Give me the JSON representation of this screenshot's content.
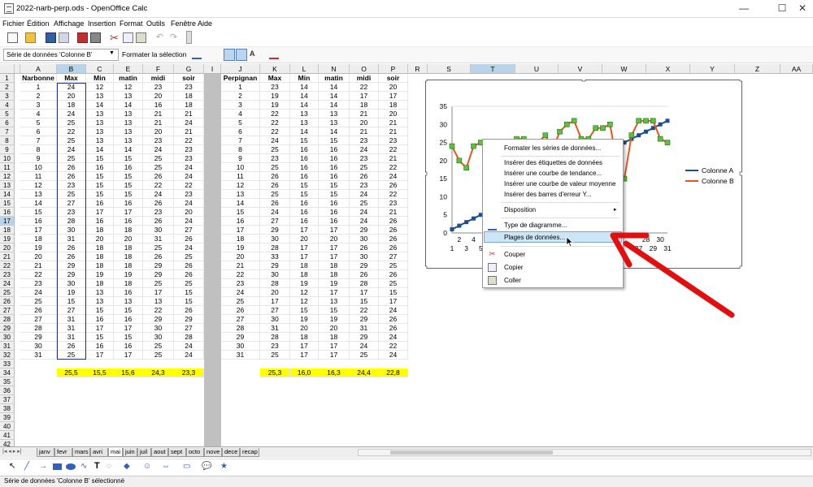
{
  "window": {
    "title": "2022-narb-perp.ods - OpenOffice Calc",
    "controls": [
      "—",
      "☐",
      "✕"
    ]
  },
  "menu": [
    "Fichier",
    "Édition",
    "Affichage",
    "Insertion",
    "Format",
    "Outils",
    "Fenêtre",
    "Aide"
  ],
  "toolbar2": {
    "name_box": "Série de données 'Colonne B'",
    "format_selection": "Formater la sélection"
  },
  "columns": [
    "A",
    "B",
    "C",
    "E",
    "F",
    "G",
    "I",
    "J",
    "K",
    "L",
    "N",
    "O",
    "P",
    "R",
    "S",
    "T",
    "U",
    "V",
    "W",
    "X",
    "Y",
    "Z",
    "AA"
  ],
  "headers_left": [
    "Narbonne",
    "Max",
    "Min",
    "matin",
    "midi",
    "soir"
  ],
  "headers_right": [
    "Perpignan",
    "Max",
    "Min",
    "matin",
    "midi",
    "soir"
  ],
  "rows": [
    [
      "1",
      "24",
      "12",
      "12",
      "23",
      "23",
      "1",
      "23",
      "14",
      "14",
      "22",
      "20"
    ],
    [
      "2",
      "20",
      "13",
      "13",
      "20",
      "18",
      "2",
      "19",
      "14",
      "14",
      "17",
      "17"
    ],
    [
      "3",
      "18",
      "14",
      "14",
      "16",
      "18",
      "3",
      "19",
      "14",
      "14",
      "18",
      "18"
    ],
    [
      "4",
      "24",
      "13",
      "13",
      "21",
      "21",
      "4",
      "22",
      "13",
      "13",
      "21",
      "20"
    ],
    [
      "5",
      "25",
      "13",
      "13",
      "21",
      "24",
      "5",
      "22",
      "13",
      "13",
      "20",
      "21"
    ],
    [
      "6",
      "22",
      "13",
      "13",
      "20",
      "21",
      "6",
      "22",
      "14",
      "14",
      "21",
      "21"
    ],
    [
      "7",
      "25",
      "13",
      "13",
      "23",
      "22",
      "7",
      "24",
      "15",
      "15",
      "23",
      "23"
    ],
    [
      "8",
      "24",
      "14",
      "14",
      "24",
      "23",
      "8",
      "25",
      "16",
      "16",
      "24",
      "22"
    ],
    [
      "9",
      "25",
      "15",
      "15",
      "25",
      "23",
      "9",
      "23",
      "16",
      "16",
      "23",
      "21"
    ],
    [
      "10",
      "26",
      "16",
      "16",
      "25",
      "24",
      "10",
      "25",
      "16",
      "16",
      "25",
      "22"
    ],
    [
      "11",
      "26",
      "15",
      "15",
      "26",
      "24",
      "11",
      "26",
      "16",
      "16",
      "26",
      "24"
    ],
    [
      "12",
      "23",
      "15",
      "15",
      "22",
      "22",
      "12",
      "26",
      "15",
      "15",
      "23",
      "26"
    ],
    [
      "13",
      "25",
      "15",
      "15",
      "24",
      "23",
      "13",
      "25",
      "15",
      "15",
      "24",
      "22"
    ],
    [
      "14",
      "27",
      "16",
      "16",
      "26",
      "24",
      "14",
      "26",
      "16",
      "16",
      "25",
      "23"
    ],
    [
      "15",
      "23",
      "17",
      "17",
      "23",
      "20",
      "15",
      "24",
      "16",
      "16",
      "24",
      "21"
    ],
    [
      "16",
      "28",
      "16",
      "16",
      "26",
      "24",
      "16",
      "27",
      "16",
      "16",
      "24",
      "26"
    ],
    [
      "17",
      "30",
      "18",
      "18",
      "30",
      "27",
      "17",
      "29",
      "17",
      "17",
      "29",
      "26"
    ],
    [
      "18",
      "31",
      "20",
      "20",
      "31",
      "26",
      "18",
      "30",
      "20",
      "20",
      "30",
      "26"
    ],
    [
      "19",
      "26",
      "18",
      "18",
      "25",
      "24",
      "19",
      "28",
      "17",
      "17",
      "26",
      "26"
    ],
    [
      "20",
      "26",
      "18",
      "18",
      "26",
      "25",
      "20",
      "33",
      "17",
      "17",
      "30",
      "27"
    ],
    [
      "21",
      "29",
      "18",
      "18",
      "29",
      "26",
      "21",
      "29",
      "18",
      "18",
      "29",
      "25"
    ],
    [
      "22",
      "29",
      "19",
      "19",
      "29",
      "26",
      "22",
      "30",
      "18",
      "18",
      "26",
      "26"
    ],
    [
      "23",
      "30",
      "18",
      "18",
      "25",
      "25",
      "23",
      "28",
      "19",
      "19",
      "28",
      "25"
    ],
    [
      "24",
      "19",
      "13",
      "16",
      "17",
      "15",
      "24",
      "20",
      "12",
      "17",
      "17",
      "15"
    ],
    [
      "25",
      "15",
      "13",
      "13",
      "13",
      "15",
      "25",
      "17",
      "12",
      "13",
      "15",
      "17"
    ],
    [
      "26",
      "27",
      "15",
      "15",
      "22",
      "26",
      "26",
      "27",
      "15",
      "15",
      "22",
      "24"
    ],
    [
      "27",
      "31",
      "16",
      "16",
      "29",
      "29",
      "27",
      "30",
      "19",
      "19",
      "29",
      "26"
    ],
    [
      "28",
      "31",
      "17",
      "17",
      "30",
      "27",
      "28",
      "31",
      "20",
      "20",
      "31",
      "26"
    ],
    [
      "29",
      "31",
      "15",
      "15",
      "30",
      "28",
      "29",
      "28",
      "18",
      "18",
      "29",
      "24"
    ],
    [
      "30",
      "26",
      "16",
      "16",
      "25",
      "24",
      "30",
      "23",
      "17",
      "17",
      "24",
      "22"
    ],
    [
      "31",
      "25",
      "17",
      "17",
      "25",
      "24",
      "31",
      "25",
      "17",
      "17",
      "25",
      "24"
    ]
  ],
  "averages": {
    "left": [
      "25,5",
      "15,5",
      "15,6",
      "24,3",
      "23,3"
    ],
    "right": [
      "25,3",
      "16,0",
      "16,3",
      "24,4",
      "22,8"
    ]
  },
  "chart_data": {
    "type": "line",
    "x": [
      1,
      2,
      3,
      4,
      5,
      6,
      7,
      8,
      9,
      10,
      11,
      12,
      13,
      14,
      15,
      16,
      17,
      18,
      19,
      20,
      21,
      22,
      23,
      24,
      25,
      26,
      27,
      28,
      29,
      30,
      31
    ],
    "x_tick_labels_top": [
      "2",
      "4",
      "",
      "28",
      "30"
    ],
    "x_tick_labels_bottom": [
      "1",
      "3",
      "5",
      "27",
      "29",
      "31"
    ],
    "ylim": [
      0,
      35
    ],
    "y_ticks": [
      "0",
      "5",
      "10",
      "15",
      "20",
      "25",
      "30",
      "35"
    ],
    "series": [
      {
        "name": "Colonne A",
        "color": "#1f4e8c",
        "values": [
          1,
          2,
          3,
          4,
          5,
          6,
          7,
          8,
          9,
          10,
          11,
          12,
          13,
          14,
          15,
          16,
          17,
          18,
          19,
          20,
          21,
          22,
          23,
          24,
          25,
          26,
          27,
          28,
          29,
          30,
          31
        ]
      },
      {
        "name": "Colonne B",
        "color": "#e8541e",
        "values": [
          24,
          20,
          18,
          24,
          25,
          22,
          25,
          24,
          25,
          26,
          26,
          23,
          25,
          27,
          23,
          28,
          30,
          31,
          26,
          26,
          29,
          29,
          30,
          19,
          15,
          27,
          31,
          31,
          31,
          26,
          25
        ]
      }
    ]
  },
  "context_menu": [
    "Formater les séries de données...",
    "Insérer des étiquettes de données",
    "Insérer une courbe de tendance...",
    "Insérer une courbe de valeur moyenne",
    "Insérer des barres d'erreur Y...",
    "Disposition",
    "Type de diagramme...",
    "Plages de données...",
    "Couper",
    "Copier",
    "Coller"
  ],
  "sheet_tabs": [
    "janv",
    "fevr",
    "mars",
    "avri",
    "mai",
    "juin",
    "juil",
    "aout",
    "sept",
    "octo",
    "nove",
    "dece",
    "recap"
  ],
  "active_tab": "mai",
  "status": "Série de données 'Colonne B' sélectionné"
}
